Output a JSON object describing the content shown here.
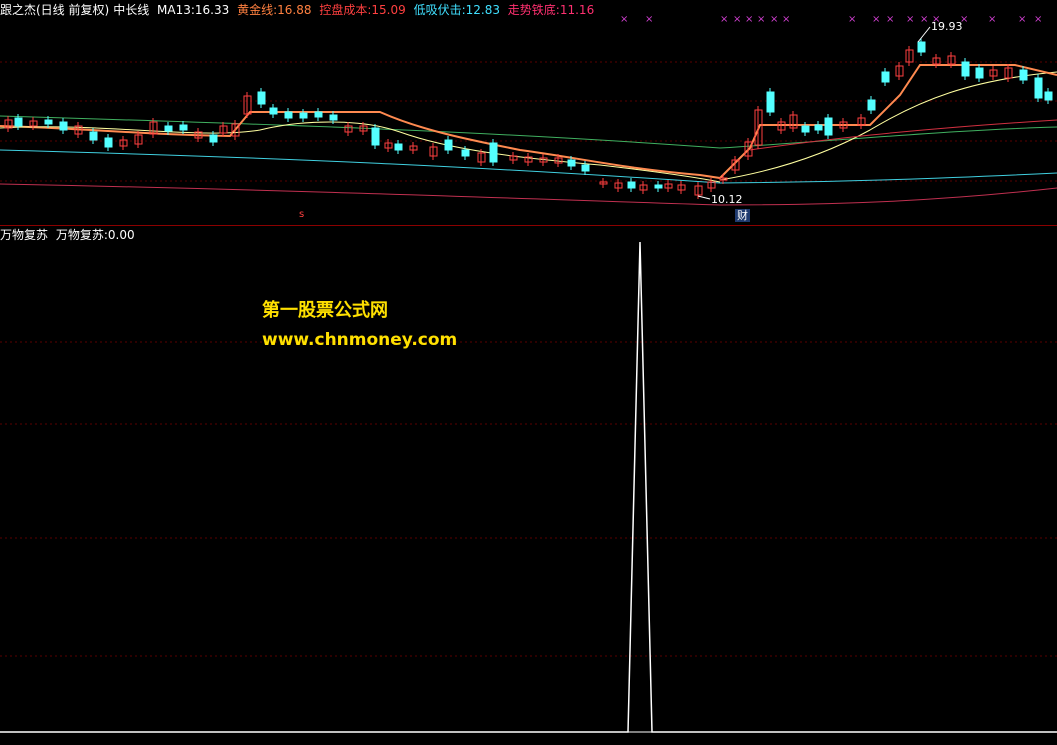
{
  "top_header": {
    "indicator_name": "跟之杰(日线 前复权)",
    "line_type": "中长线",
    "items": [
      {
        "label": "MA13:",
        "value": "16.33",
        "color": "#ffffff"
      },
      {
        "label": "黄金线:",
        "value": "16.88",
        "color": "#ff8040"
      },
      {
        "label": "控盘成本:",
        "value": "15.09",
        "color": "#ff4040"
      },
      {
        "label": "低吸伏击:",
        "value": "12.83",
        "color": "#40e0ff"
      },
      {
        "label": "走势铁底:",
        "value": "11.16",
        "color": "#ff3070"
      }
    ]
  },
  "chart_labels": {
    "high_marker": "19.93",
    "low_marker": "10.12",
    "event_badge": "财",
    "s_marker": "s"
  },
  "bottom_header": {
    "indicator_name": "万物复苏",
    "item_label": "万物复苏:",
    "item_value": "0.00"
  },
  "watermark": {
    "line1": "第一股票公式网",
    "line2": "www.chnmoney.com"
  },
  "colors": {
    "up_candle": "#ff4040",
    "down_candle": "#54ffff",
    "ma13": "#ffffa0",
    "gold_line": "#ff8a50",
    "control_cost": "#d03040",
    "dip_line": "#40d0e0",
    "bottom_line": "#c03050",
    "signal_x": "#d040d0"
  },
  "chart_data": {
    "type": "line",
    "panel": "万物复苏 signal",
    "x_index": [
      0,
      1,
      2,
      3,
      4,
      5,
      6,
      7,
      8,
      9,
      10,
      11,
      12,
      13,
      14,
      15,
      16,
      17,
      18,
      19,
      20,
      21,
      22,
      23,
      24,
      25,
      26,
      27,
      28,
      29,
      30,
      31,
      32,
      33,
      34,
      35,
      36,
      37,
      38,
      39,
      40,
      41,
      42,
      43,
      44,
      45,
      46,
      47,
      48,
      49,
      50,
      51,
      52,
      53,
      54,
      55,
      56,
      57,
      58,
      59,
      60,
      61,
      62,
      63,
      64,
      65,
      66,
      67,
      68,
      69,
      70,
      71,
      72,
      73,
      74,
      75,
      76,
      77,
      78,
      79,
      80,
      81,
      82,
      83,
      84,
      85,
      86,
      87,
      88
    ],
    "values": [
      0,
      0,
      0,
      0,
      0,
      0,
      0,
      0,
      0,
      0,
      0,
      0,
      0,
      0,
      0,
      0,
      0,
      0,
      0,
      0,
      0,
      0,
      0,
      0,
      0,
      0,
      0,
      0,
      0,
      0,
      0,
      0,
      0,
      0,
      0,
      0,
      0,
      0,
      0,
      0,
      0,
      0,
      0,
      0,
      0,
      0,
      0,
      0,
      0,
      0,
      0,
      0,
      0,
      1,
      0,
      0,
      0,
      0,
      0,
      0,
      0,
      0,
      0,
      0,
      0,
      0,
      0,
      0,
      0,
      0,
      0,
      0,
      0,
      0,
      0,
      0,
      0,
      0,
      0,
      0,
      0,
      0,
      0,
      0,
      0,
      0,
      0,
      0,
      0
    ],
    "ylim": [
      0,
      1
    ]
  }
}
